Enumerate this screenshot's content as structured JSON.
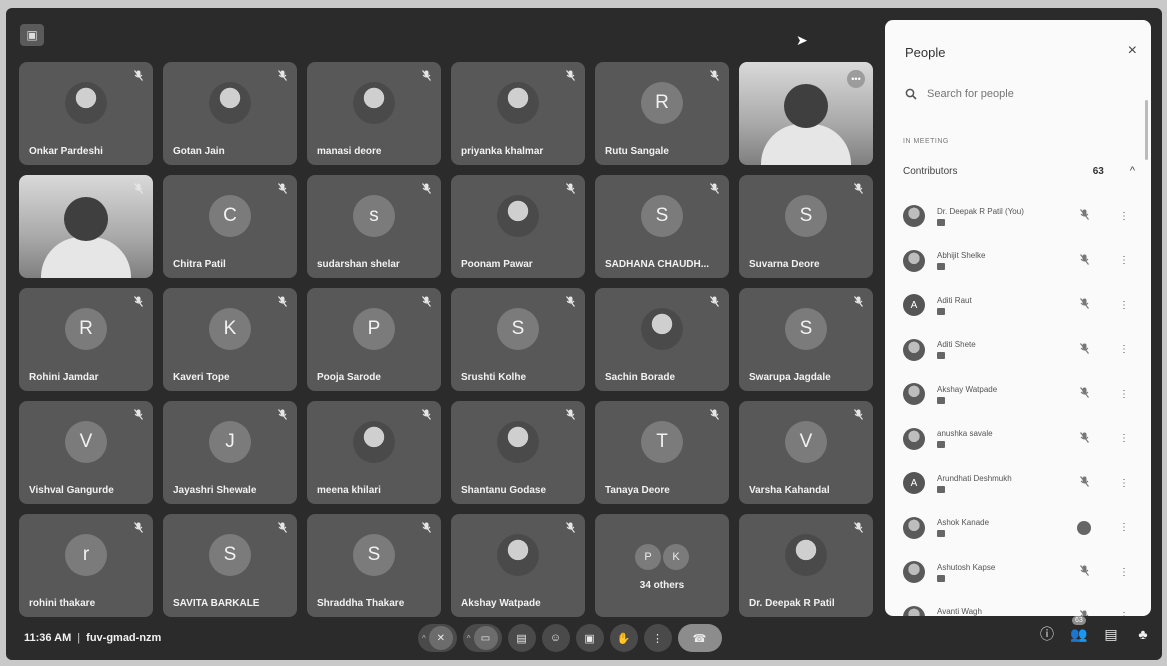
{
  "meeting": {
    "time": "11:36 AM",
    "separator": "|",
    "code": "fuv-gmad-nzm"
  },
  "grid": {
    "tiles": [
      {
        "name": "Onkar Pardeshi",
        "initial": "",
        "type": "photo"
      },
      {
        "name": "Gotan Jain",
        "initial": "",
        "type": "photo"
      },
      {
        "name": "manasi deore",
        "initial": "",
        "type": "photo"
      },
      {
        "name": "priyanka khalmar",
        "initial": "",
        "type": "photo"
      },
      {
        "name": "Rutu Sangale",
        "initial": "R",
        "type": "letter"
      },
      {
        "name": "",
        "initial": "",
        "type": "video"
      },
      {
        "name": "",
        "initial": "",
        "type": "video"
      },
      {
        "name": "Chitra Patil",
        "initial": "C",
        "type": "letter"
      },
      {
        "name": "sudarshan shelar",
        "initial": "s",
        "type": "letter"
      },
      {
        "name": "Poonam Pawar",
        "initial": "",
        "type": "photo"
      },
      {
        "name": "SADHANA CHAUDH...",
        "initial": "S",
        "type": "letter"
      },
      {
        "name": "Suvarna Deore",
        "initial": "S",
        "type": "letter"
      },
      {
        "name": "Rohini Jamdar",
        "initial": "R",
        "type": "letter"
      },
      {
        "name": "Kaveri Tope",
        "initial": "K",
        "type": "letter"
      },
      {
        "name": "Pooja Sarode",
        "initial": "P",
        "type": "letter"
      },
      {
        "name": "Srushti Kolhe",
        "initial": "S",
        "type": "letter"
      },
      {
        "name": "Sachin Borade",
        "initial": "",
        "type": "photo"
      },
      {
        "name": "Swarupa Jagdale",
        "initial": "S",
        "type": "letter"
      },
      {
        "name": "Vishval Gangurde",
        "initial": "V",
        "type": "letter"
      },
      {
        "name": "Jayashri Shewale",
        "initial": "J",
        "type": "letter"
      },
      {
        "name": "meena khilari",
        "initial": "",
        "type": "photo"
      },
      {
        "name": "Shantanu Godase",
        "initial": "",
        "type": "photo"
      },
      {
        "name": "Tanaya Deore",
        "initial": "T",
        "type": "letter"
      },
      {
        "name": "Varsha Kahandal",
        "initial": "V",
        "type": "letter"
      },
      {
        "name": "rohini thakare",
        "initial": "r",
        "type": "letter"
      },
      {
        "name": "SAVITA BARKALE",
        "initial": "S",
        "type": "letter"
      },
      {
        "name": "Shraddha Thakare",
        "initial": "S",
        "type": "letter"
      },
      {
        "name": "Akshay Watpade",
        "initial": "",
        "type": "photo"
      },
      {
        "name": "",
        "initial": "",
        "type": "others",
        "others_label": "34 others",
        "others_initials": [
          "P",
          "K"
        ]
      },
      {
        "name": "Dr. Deepak R Patil",
        "initial": "",
        "type": "photo"
      }
    ]
  },
  "panel": {
    "title": "People",
    "close_icon": "×",
    "search_placeholder": "Search for people",
    "section_label": "IN MEETING",
    "contributors_label": "Contributors",
    "contributors_count": "63",
    "people": [
      {
        "name": "Dr. Deepak R Patil (You)",
        "type": "photo",
        "mic": "muted"
      },
      {
        "name": "Abhijit Shelke",
        "type": "photo",
        "mic": "muted"
      },
      {
        "name": "Aditi Raut",
        "type": "letter",
        "initial": "A",
        "mic": "muted"
      },
      {
        "name": "Aditi Shete",
        "type": "photo",
        "mic": "muted"
      },
      {
        "name": "Akshay Watpade",
        "type": "photo",
        "mic": "muted"
      },
      {
        "name": "anushka savale",
        "type": "photo",
        "mic": "muted"
      },
      {
        "name": "Arundhati Deshmukh",
        "type": "letter",
        "initial": "A",
        "mic": "muted"
      },
      {
        "name": "Ashok Kanade",
        "type": "photo",
        "mic": "active"
      },
      {
        "name": "Ashutosh Kapse",
        "type": "photo",
        "mic": "muted"
      },
      {
        "name": "Avanti Wagh",
        "type": "photo",
        "mic": "muted"
      }
    ]
  },
  "bottom": {
    "people_badge": "63"
  },
  "icons": {
    "mic_off": "🎙",
    "more": "⋮"
  }
}
